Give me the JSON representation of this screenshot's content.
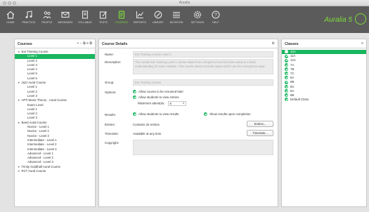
{
  "window": {
    "title": "Auralia"
  },
  "toolbar": {
    "items": [
      {
        "label": "HOME",
        "icon": "home-icon"
      },
      {
        "label": "PRACTICE",
        "icon": "music-note-icon"
      },
      {
        "label": "PEOPLE",
        "icon": "people-icon"
      },
      {
        "label": "MESSAGES",
        "icon": "envelope-icon"
      },
      {
        "label": "SYLLABUS",
        "icon": "book-icon"
      },
      {
        "label": "TESTS",
        "icon": "pencil-icon"
      },
      {
        "label": "COURSES",
        "icon": "courses-icon"
      },
      {
        "label": "REPORTS",
        "icon": "chart-icon"
      },
      {
        "label": "LIBRARY",
        "icon": "library-icon"
      },
      {
        "label": "NOTATION",
        "icon": "notation-icon"
      },
      {
        "label": "SETTINGS",
        "icon": "gear-icon"
      },
      {
        "label": "HELP",
        "icon": "help-icon"
      }
    ],
    "logo": "Auralia 5",
    "active_color": "#7edc3a"
  },
  "courses": {
    "title": "Courses",
    "actions": "+ − ⧉ ≡ ⧉",
    "tree": [
      {
        "label": "Ear Training Course",
        "level": 0,
        "group": true
      },
      {
        "label": "Level 1",
        "level": 1,
        "selected": true
      },
      {
        "label": "Level 2",
        "level": 1
      },
      {
        "label": "Level 3",
        "level": 1
      },
      {
        "label": "Level 4",
        "level": 1
      },
      {
        "label": "Level 5",
        "level": 1
      },
      {
        "label": "Level 6",
        "level": 1
      },
      {
        "label": "Jazz Aural Course",
        "level": 0,
        "group": true
      },
      {
        "label": "Level 1",
        "level": 1
      },
      {
        "label": "Level 2",
        "level": 1
      },
      {
        "label": "Level 3",
        "level": 1
      },
      {
        "label": "AP® Music Theory - Aural Course",
        "level": 0,
        "group": true
      },
      {
        "label": "Exam Level",
        "level": 1
      },
      {
        "label": "Level 1",
        "level": 1
      },
      {
        "label": "Level 2",
        "level": 1
      },
      {
        "label": "Level 3",
        "level": 1
      },
      {
        "label": "Band Aural Course",
        "level": 0,
        "group": true
      },
      {
        "label": "Novice - Level 1",
        "level": 1
      },
      {
        "label": "Novice - Level 2",
        "level": 1
      },
      {
        "label": "Novice - Level 3",
        "level": 1
      },
      {
        "label": "Intermediate - Level 1",
        "level": 1
      },
      {
        "label": "Intermediate - Level 2",
        "level": 1
      },
      {
        "label": "Intermediate - Level 3",
        "level": 1
      },
      {
        "label": "Advanced - Level 1",
        "level": 1
      },
      {
        "label": "Advanced - Level 2",
        "level": 1
      },
      {
        "label": "Advanced - Level 3",
        "level": 1
      },
      {
        "label": "Trinity Guildhall Aural Course",
        "level": 0,
        "group": true
      },
      {
        "label": "RCT Aural Course",
        "level": 0,
        "group": true
      }
    ]
  },
  "details": {
    "title": "Course Details",
    "gear": "⚙",
    "name_label": "Name:",
    "name_value": "Ear Training Course Level 1",
    "desc_label": "Description:",
    "desc_value": "The Auralia Ear Training Level 1 course starts from a beginner level but does assume a basic understanding of music notation. This course doesn't include topics which use the microphone input.",
    "group_label": "Group:",
    "group_value": "Ear Training Course",
    "options_label": "Options:",
    "opt1": "Allow course to be resumed later",
    "opt2": "Allow students to view entries",
    "max_attempts_label": "Maximum attempts:",
    "max_attempts_value": "5",
    "results_label": "Results:",
    "res1": "Allow students to view results",
    "res2": "Show results upon completion",
    "entries_label": "Entries:",
    "entries_value": "Contains 32 entries",
    "entries_button": "Entries...",
    "timeslots_label": "Timeslots:",
    "timeslots_value": "Available at any time",
    "timeslots_button": "Timeslots...",
    "copyright_label": "Copyright:"
  },
  "classes": {
    "title": "Classes",
    "items": [
      {
        "label": "10A",
        "selected": true
      },
      {
        "label": "11A"
      },
      {
        "label": "12A"
      },
      {
        "label": "7A"
      },
      {
        "label": "7B"
      },
      {
        "label": "7C"
      },
      {
        "label": "8A"
      },
      {
        "label": "8B"
      },
      {
        "label": "8C"
      },
      {
        "label": "9A"
      },
      {
        "label": "9B"
      },
      {
        "label": "Default Class"
      }
    ]
  }
}
